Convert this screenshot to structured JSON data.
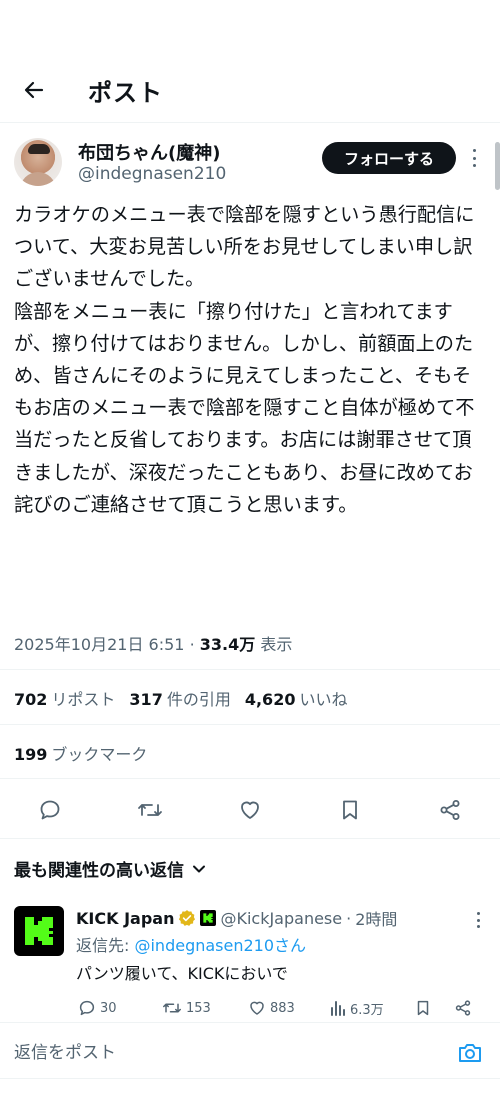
{
  "header": {
    "back_icon": "arrow-left-icon",
    "title": "ポスト"
  },
  "post": {
    "author": {
      "name": "布団ちゃん(魔神)",
      "handle": "@indegnasen210",
      "follow_label": "フォローする"
    },
    "body": "カラオケのメニュー表で陰部を隠すという愚行配信について、大変お見苦しい所をお見せしてしまい申し訳ございませんでした。\n陰部をメニュー表に「擦り付けた」と言われてますが、擦り付けてはおりません。しかし、前額面上のため、皆さんにそのように見えてしまったこと、そもそもお店のメニュー表で陰部を隠すこと自体が極めて不当だったと反省しております。お店には謝罪させて頂きましたが、深夜だったこともあり、お昼に改めてお詫びのご連絡させて頂こうと思います。",
    "timestamp": "2025年10月21日 6:51",
    "views_count": "33.4万",
    "views_label": "表示",
    "reposts_count": "702",
    "reposts_label": "リポスト",
    "quotes_count": "317",
    "quotes_label": "件の引用",
    "likes_count": "4,620",
    "likes_label": "いいね",
    "bookmarks_count": "199",
    "bookmarks_label": "ブックマーク"
  },
  "replies_sort": {
    "label": "最も関連性の高い返信"
  },
  "reply": {
    "name": "KICK Japan",
    "handle": "@KickJapanese",
    "time": "2時間",
    "reply_to_label": "返信先: ",
    "reply_to_mention": "@indegnasen210さん",
    "text": "パンツ履いて、KICKにおいで",
    "comments": "30",
    "reposts": "153",
    "likes": "883",
    "views": "6.3万"
  },
  "composer": {
    "placeholder": "返信をポスト",
    "camera_icon": "camera-icon"
  },
  "colors": {
    "text_primary": "#0f1419",
    "text_secondary": "#536471",
    "link": "#1d9bf0",
    "divider": "#eff3f4",
    "kick_green": "#53fc18",
    "verified_gold": "#e2b719"
  }
}
